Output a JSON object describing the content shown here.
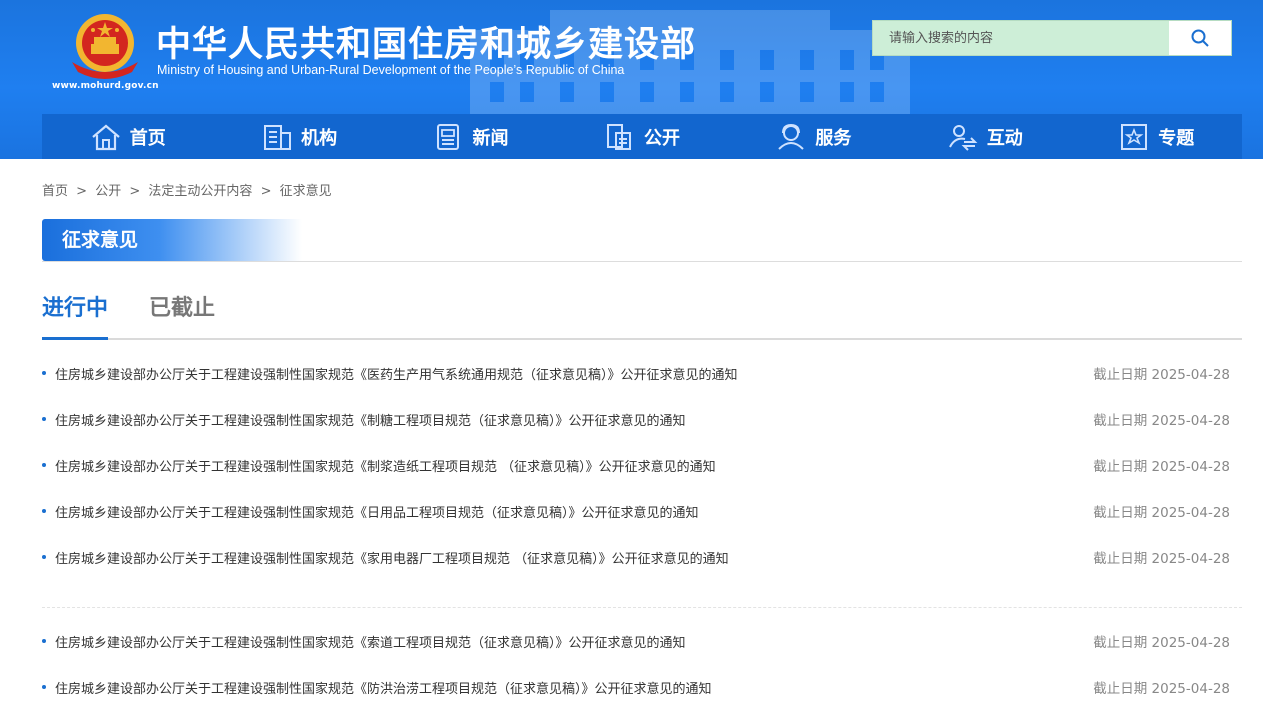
{
  "header": {
    "title_cn": "中华人民共和国住房和城乡建设部",
    "title_en": "Ministry of Housing and Urban-Rural Development of the People’s Republic of China",
    "site_url": "www.mohurd.gov.cn",
    "emblem_icon": "national-emblem-icon",
    "search": {
      "placeholder": "请输入搜索的内容",
      "value": "",
      "icon": "search-icon"
    },
    "colors": {
      "header_bg": "#1f7ff0",
      "nav_bg": "#1266cf",
      "search_bg": "#cdeed7"
    }
  },
  "nav": [
    {
      "label": "首页",
      "icon": "home-icon"
    },
    {
      "label": "机构",
      "icon": "building-icon"
    },
    {
      "label": "新闻",
      "icon": "news-icon"
    },
    {
      "label": "公开",
      "icon": "document-icon"
    },
    {
      "label": "服务",
      "icon": "service-icon"
    },
    {
      "label": "互动",
      "icon": "interaction-icon"
    },
    {
      "label": "专题",
      "icon": "topic-star-icon"
    }
  ],
  "breadcrumb": {
    "items": [
      "首页",
      "公开",
      "法定主动公开内容",
      "征求意见"
    ],
    "separator": ">"
  },
  "section": {
    "title": "征求意见",
    "accent": "#1a6fdc"
  },
  "tabs": [
    {
      "label": "进行中",
      "active": true
    },
    {
      "label": "已截止",
      "active": false
    }
  ],
  "list": [
    {
      "title": "住房城乡建设部办公厅关于工程建设强制性国家规范《医药生产用气系统通用规范（征求意见稿）》公开征求意见的通知",
      "date": "截止日期 2025-04-28"
    },
    {
      "title": "住房城乡建设部办公厅关于工程建设强制性国家规范《制糖工程项目规范（征求意见稿）》公开征求意见的通知",
      "date": "截止日期 2025-04-28"
    },
    {
      "title": "住房城乡建设部办公厅关于工程建设强制性国家规范《制浆造纸工程项目规范 （征求意见稿）》公开征求意见的通知",
      "date": "截止日期 2025-04-28"
    },
    {
      "title": "住房城乡建设部办公厅关于工程建设强制性国家规范《日用品工程项目规范（征求意见稿）》公开征求意见的通知",
      "date": "截止日期 2025-04-28"
    },
    {
      "title": "住房城乡建设部办公厅关于工程建设强制性国家规范《家用电器厂工程项目规范 （征求意见稿）》公开征求意见的通知",
      "date": "截止日期 2025-04-28"
    },
    {
      "title": "住房城乡建设部办公厅关于工程建设强制性国家规范《索道工程项目规范（征求意见稿）》公开征求意见的通知",
      "date": "截止日期 2025-04-28"
    },
    {
      "title": "住房城乡建设部办公厅关于工程建设强制性国家规范《防洪治涝工程项目规范（征求意见稿）》公开征求意见的通知",
      "date": "截止日期 2025-04-28"
    }
  ]
}
